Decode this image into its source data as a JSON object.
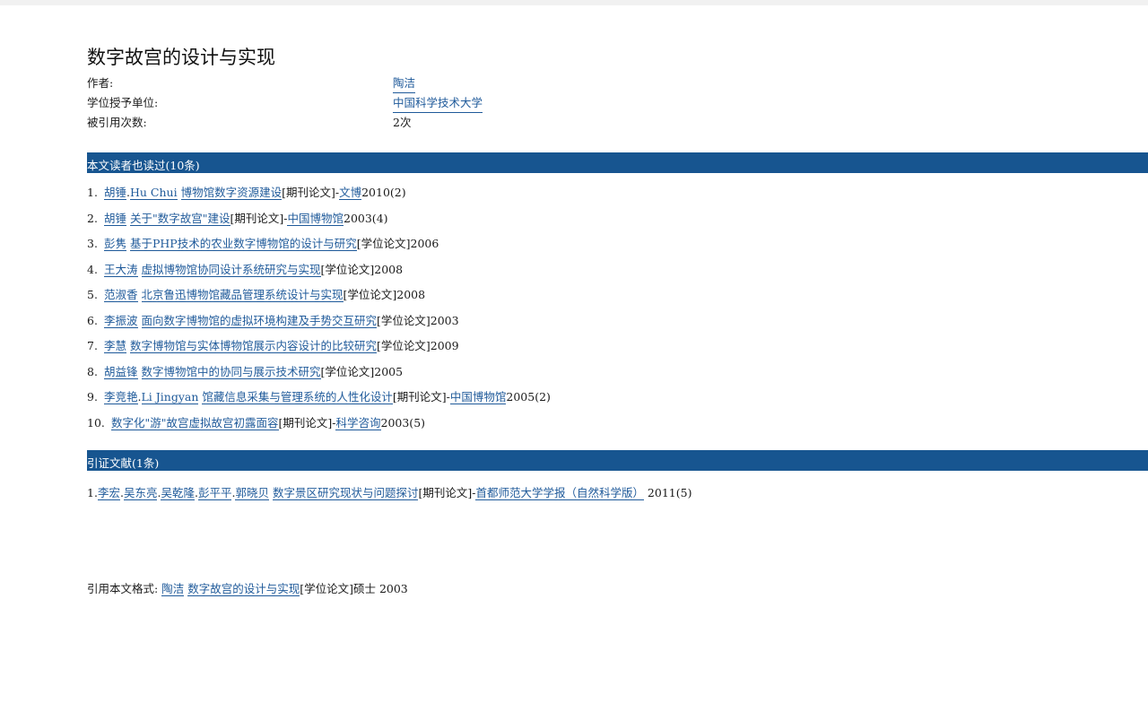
{
  "doc": {
    "title": "数字故宫的设计与实现",
    "meta": [
      {
        "label": "作者:",
        "value": "陶洁",
        "linked": true
      },
      {
        "label": "学位授予单位:",
        "value": "中国科学技术大学",
        "linked": true
      },
      {
        "label": "被引用次数:",
        "value": "2次",
        "linked": false
      }
    ]
  },
  "readers_section": {
    "heading": "本文读者也读过(10条)",
    "items": [
      {
        "n": "1.",
        "authors": [
          "胡锤",
          "Hu Chui"
        ],
        "title": "博物馆数字资源建设",
        "type": "[期刊论文]-",
        "source": "文博",
        "tail": "2010(2)"
      },
      {
        "n": "2.",
        "authors": [
          "胡锤"
        ],
        "title": "关于\"数字故宫\"建设",
        "type": "[期刊论文]-",
        "source": "中国博物馆",
        "tail": "2003(4)"
      },
      {
        "n": "3.",
        "authors": [
          "彭隽"
        ],
        "title": "基于PHP技术的农业数字博物馆的设计与研究",
        "type": "[学位论文]2006",
        "source": "",
        "tail": ""
      },
      {
        "n": "4.",
        "authors": [
          "王大涛"
        ],
        "title": "虚拟博物馆协同设计系统研究与实现",
        "type": "[学位论文]2008",
        "source": "",
        "tail": ""
      },
      {
        "n": "5.",
        "authors": [
          "范淑香"
        ],
        "title": "北京鲁迅博物馆藏品管理系统设计与实现",
        "type": "[学位论文]2008",
        "source": "",
        "tail": ""
      },
      {
        "n": "6.",
        "authors": [
          "李振波"
        ],
        "title": "面向数字博物馆的虚拟环境构建及手势交互研究",
        "type": "[学位论文]2003",
        "source": "",
        "tail": ""
      },
      {
        "n": "7.",
        "authors": [
          "李慧"
        ],
        "title": "数字博物馆与实体博物馆展示内容设计的比较研究",
        "type": "[学位论文]2009",
        "source": "",
        "tail": ""
      },
      {
        "n": "8.",
        "authors": [
          "胡益锋"
        ],
        "title": "数字博物馆中的协同与展示技术研究",
        "type": "[学位论文]2005",
        "source": "",
        "tail": ""
      },
      {
        "n": "9.",
        "authors": [
          "李竞艳",
          "Li Jingyan"
        ],
        "title": "馆藏信息采集与管理系统的人性化设计",
        "type": "[期刊论文]-",
        "source": "中国博物馆",
        "tail": "2005(2)"
      },
      {
        "n": "10.",
        "authors": [],
        "title": "数字化\"游\"故宫虚拟故宫初露面容",
        "type": "[期刊论文]-",
        "source": "科学咨询",
        "tail": "2003(5)"
      }
    ]
  },
  "cited_section": {
    "heading": "引证文献(1条)",
    "items": [
      {
        "n": "1.",
        "authors": [
          "李宏",
          "吴东亮",
          "吴乾隆",
          "彭平平",
          "郭晓贝"
        ],
        "title": "数字景区研究现状与问题探讨",
        "type": "[期刊论文]-",
        "source": "首都师范大学学报（自然科学版）",
        "tail": " 2011(5)"
      }
    ]
  },
  "citation_format": {
    "label": "引用本文格式:",
    "author": "陶洁",
    "title": "数字故宫的设计与实现",
    "tail": "[学位论文]硕士 2003"
  }
}
